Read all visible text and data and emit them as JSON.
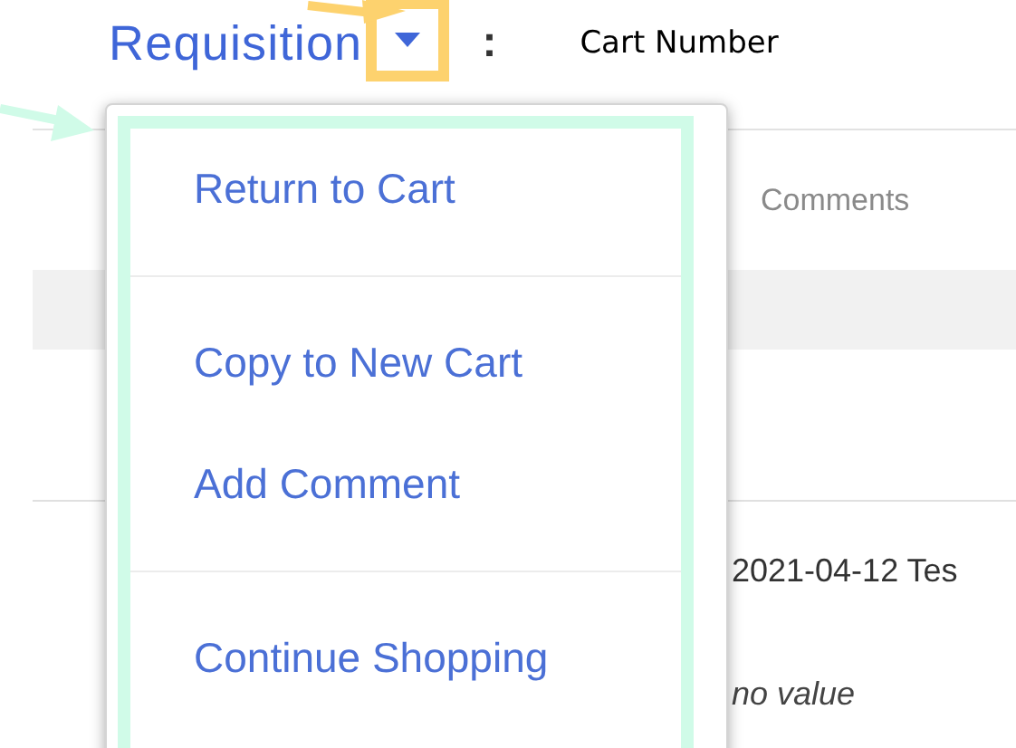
{
  "header": {
    "title": "Requisition",
    "separator": ":",
    "annotation": "Cart Number"
  },
  "menu": {
    "sections": [
      {
        "items": [
          {
            "label": "Return to Cart"
          }
        ]
      },
      {
        "items": [
          {
            "label": "Copy to New Cart"
          },
          {
            "label": "Add Comment"
          }
        ]
      },
      {
        "items": [
          {
            "label": "Continue Shopping"
          }
        ]
      }
    ]
  },
  "background": {
    "tab": "Comments",
    "cell": "2021-04-12 Tes",
    "empty_value": "no value"
  }
}
